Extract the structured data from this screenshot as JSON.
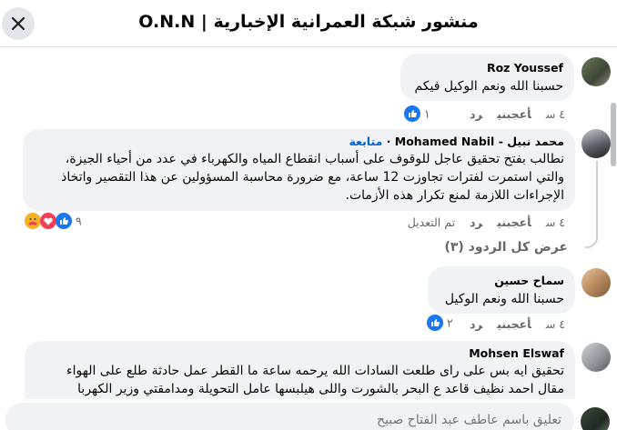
{
  "header": {
    "title": "منشور شبكة العمرانية الإخبارية | O.N.N"
  },
  "comments": [
    {
      "author": "Roz Youssef",
      "text": "حسبنا الله ونعم الوكيل فيكم",
      "time": "٤ س",
      "like": "أعجبني",
      "reply": "رد",
      "reaction_count": "١"
    },
    {
      "author": "محمد نبيل - Mohamed Nabil",
      "follow": "متابعة",
      "lines": [
        "نطالب بفتح تحقيق عاجل للوقوف على أسباب انقطاع المياه والكهرباء في عدد من أحياء الجيزة،",
        "والتي استمرت لفترات تجاوزت 12 ساعة، مع ضرورة محاسبة المسؤولين عن هذا التقصير واتخاذ",
        "الإجراءات اللازمة لمنع تكرار هذه الأزمات."
      ],
      "time": "٤ س",
      "like": "أعجبني",
      "reply": "رد",
      "edited": "تم التعديل",
      "reaction_count": "٩",
      "view_replies": "عرض كل الردود (٣)"
    },
    {
      "author": "سماح حسين",
      "text": "حسبنا الله ونعم الوكيل",
      "time": "٤ س",
      "like": "أعجبني",
      "reply": "رد",
      "reaction_count": "٢"
    },
    {
      "author": "Mohsen Elswaf",
      "lines": [
        "تحقيق ايه بس على راى طلعت السادات الله يرحمه ساعة ما القطر عمل حادثة طلع على الهواء",
        "مقال احمد نظيف قاعد ع البحر بالشورت واللى هيلبسها عامل التحويلة ومدامقتي وزير الكهربا"
      ]
    }
  ],
  "composer": {
    "placeholder": "تعليق باسم عاطف عبد الفتاح صبيح"
  },
  "colors": {
    "like_blue": "#1877f2",
    "love_red": "#f33e58",
    "care_yellow": "#f7b125",
    "follow_blue": "#0064d1"
  }
}
